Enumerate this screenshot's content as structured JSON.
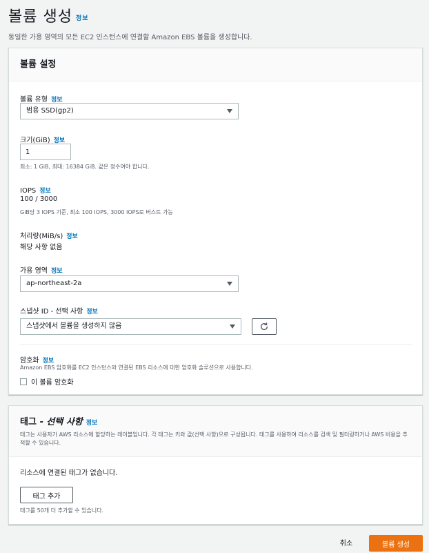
{
  "header": {
    "title": "볼륨 생성",
    "info": "정보",
    "description": "동일한 가용 영역의 모든 EC2 인스턴스에 연결할 Amazon EBS 볼륨을 생성합니다."
  },
  "settings": {
    "title": "볼륨 설정",
    "volume_type": {
      "label": "볼륨 유형",
      "info": "정보",
      "value": "범용 SSD(gp2)"
    },
    "size": {
      "label": "크기(GiB)",
      "info": "정보",
      "value": "1",
      "hint": "최소: 1 GiB, 최대: 16384 GiB. 값은 정수여야 합니다."
    },
    "iops": {
      "label": "IOPS",
      "info": "정보",
      "value": "100 / 3000",
      "hint": "GiB당 3 IOPS 기준, 최소 100 IOPS, 3000 IOPS로 버스트 가능"
    },
    "throughput": {
      "label": "처리량(MiB/s)",
      "info": "정보",
      "value": "해당 사항 없음"
    },
    "az": {
      "label": "가용 영역",
      "info": "정보",
      "value": "ap-northeast-2a"
    },
    "snapshot": {
      "label": "스냅샷 ID - ",
      "label_opt": "선택 사항",
      "info": "정보",
      "value": "스냅샷에서 볼륨을 생성하지 않음"
    },
    "encryption": {
      "label": "암호화",
      "info": "정보",
      "hint": "Amazon EBS 암호화를 EC2 인스턴스와 연결된 EBS 리소스에 대한 암호화 솔루션으로 사용합니다.",
      "checkbox_label": "이 볼륨 암호화",
      "checked": false
    }
  },
  "tags": {
    "title": "태그 - ",
    "title_opt": "선택 사항",
    "info": "정보",
    "description": "태그는 사용자가 AWS 리소스에 할당하는 레이블입니다. 각 태그는 키와 값(선택 사항)으로 구성됩니다. 태그를 사용하여 리소스를 검색 및 필터링하거나 AWS 비용을 추적할 수 있습니다.",
    "empty": "리소스에 연결된 태그가 없습니다.",
    "add_button": "태그 추가",
    "limit_hint": "태그를 50개 더 추가할 수 있습니다."
  },
  "footer": {
    "cancel": "취소",
    "create": "볼륨 생성"
  },
  "colors": {
    "primary": "#ec7211",
    "link": "#0073bb",
    "background": "#f2f3f3"
  }
}
